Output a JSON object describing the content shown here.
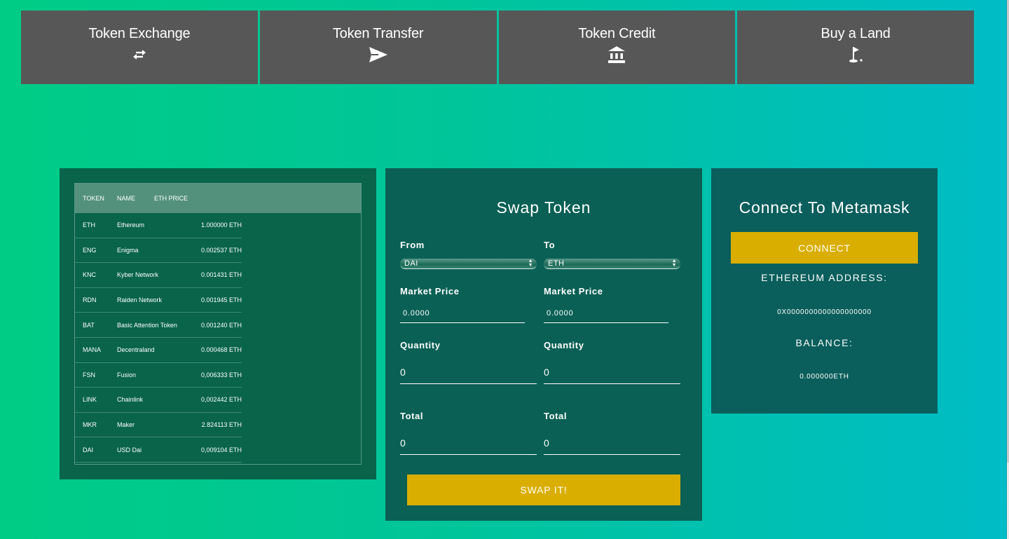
{
  "nav": {
    "items": [
      {
        "label": "Token Exchange",
        "icon": "exchange-arrows-icon"
      },
      {
        "label": "Token Transfer",
        "icon": "paper-plane-icon"
      },
      {
        "label": "Token Credit",
        "icon": "bank-icon"
      },
      {
        "label": "Buy a Land",
        "icon": "golf-flag-icon"
      }
    ]
  },
  "token_table": {
    "headers": [
      "TOKEN",
      "NAME",
      "ETH PRICE"
    ],
    "rows": [
      {
        "token": "ETH",
        "name": "Ethereum",
        "price": "1.000000 ETH"
      },
      {
        "token": "ENG",
        "name": "Enigma",
        "price": "0.002537 ETH"
      },
      {
        "token": "KNC",
        "name": "Kyber Network",
        "price": "0.001431 ETH"
      },
      {
        "token": "RDN",
        "name": "Raiden Network",
        "price": "0.001945 ETH"
      },
      {
        "token": "BAT",
        "name": "Basic Attention Token",
        "price": "0.001240 ETH"
      },
      {
        "token": "MANA",
        "name": "Decentraland",
        "price": "0.000468 ETH"
      },
      {
        "token": "FSN",
        "name": "Fusion",
        "price": "0,006333 ETH"
      },
      {
        "token": "LINK",
        "name": "Chainlink",
        "price": "0,002442 ETH"
      },
      {
        "token": "MKR",
        "name": "Maker",
        "price": "2.824113 ETH"
      },
      {
        "token": "DAI",
        "name": "USD Dai",
        "price": "0,009104 ETH"
      }
    ]
  },
  "swap": {
    "title": "Swap Token",
    "from": {
      "label": "From",
      "selected": "DAI",
      "market_price_label": "Market Price",
      "market_price": "0.0000",
      "quantity_label": "Quantity",
      "quantity": "0",
      "total_label": "Total",
      "total": "0"
    },
    "to": {
      "label": "To",
      "selected": "ETH",
      "market_price_label": "Market Price",
      "market_price": "0.0000",
      "quantity_label": "Quantity",
      "quantity": "0",
      "total_label": "Total",
      "total": "0"
    },
    "button_label": "SWAP IT!"
  },
  "metamask": {
    "title": "Connect To Metamask",
    "connect_label": "CONNECT",
    "address_label": "ETHEREUM ADDRESS:",
    "address": "0X0000000000000000000",
    "balance_label": "BALANCE:",
    "balance": "0.000000ETH"
  },
  "colors": {
    "nav_bg": "#575757",
    "accent_gold": "#d9ae00",
    "panel_green": "#09644a",
    "panel_teal": "#0a5e5c"
  }
}
